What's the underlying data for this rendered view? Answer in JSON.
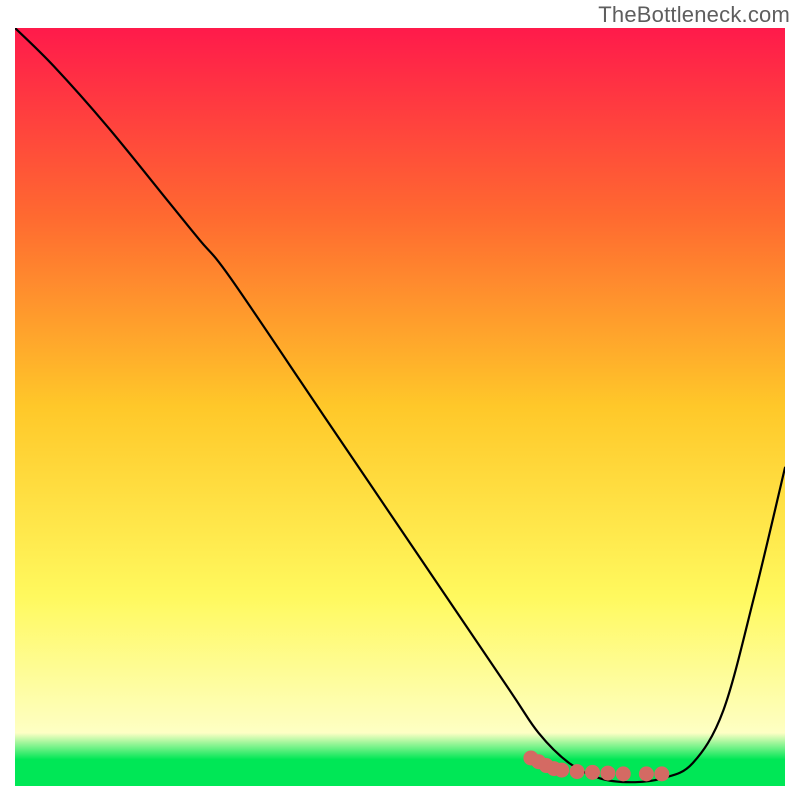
{
  "watermark": "TheBottleneck.com",
  "chart_data": {
    "type": "line",
    "title": "",
    "xlabel": "",
    "ylabel": "",
    "xlim": [
      0,
      100
    ],
    "ylim": [
      0,
      100
    ],
    "background_gradient": {
      "stops": [
        {
          "offset": 0,
          "color": "#ff1a4b"
        },
        {
          "offset": 25,
          "color": "#ff6a30"
        },
        {
          "offset": 50,
          "color": "#ffc829"
        },
        {
          "offset": 75,
          "color": "#fff95e"
        },
        {
          "offset": 93,
          "color": "#feffc4"
        },
        {
          "offset": 96.5,
          "color": "#00e756"
        },
        {
          "offset": 100,
          "color": "#00e756"
        }
      ]
    },
    "series": [
      {
        "name": "bottleneck-curve",
        "color": "#000000",
        "x": [
          0,
          5,
          12,
          20,
          24,
          28,
          40,
          52,
          64,
          68,
          72,
          76,
          80,
          84,
          88,
          92,
          96,
          100
        ],
        "y": [
          100,
          95,
          87,
          77,
          72,
          67,
          49,
          31,
          13,
          7,
          3,
          1,
          0.5,
          1,
          3,
          10,
          25,
          42
        ]
      }
    ],
    "markers": {
      "name": "highlight-segment",
      "color": "#d46a63",
      "points": [
        {
          "x": 67,
          "y": 3.7
        },
        {
          "x": 68,
          "y": 3.2
        },
        {
          "x": 69,
          "y": 2.7
        },
        {
          "x": 70,
          "y": 2.3
        },
        {
          "x": 71,
          "y": 2.1
        },
        {
          "x": 73,
          "y": 1.9
        },
        {
          "x": 75,
          "y": 1.8
        },
        {
          "x": 77,
          "y": 1.7
        },
        {
          "x": 79,
          "y": 1.6
        },
        {
          "x": 82,
          "y": 1.6
        },
        {
          "x": 84,
          "y": 1.6
        }
      ]
    }
  }
}
